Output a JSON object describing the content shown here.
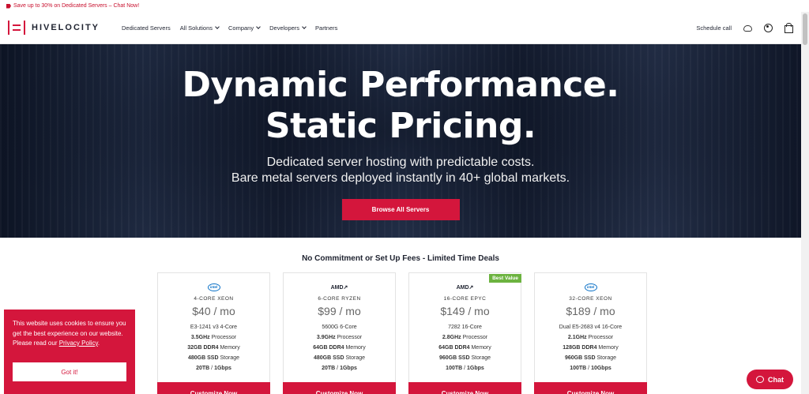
{
  "promo": {
    "text": "Save up to 30% on Dedicated Servers – Chat Now!"
  },
  "nav": {
    "logo": "HIVELOCITY",
    "links": [
      "Dedicated Servers",
      "All Solutions",
      "Company",
      "Developers",
      "Partners"
    ],
    "schedule": "Schedule call"
  },
  "hero": {
    "title_line1": "Dynamic Performance.",
    "title_line2": "Static Pricing.",
    "sub_line1": "Dedicated server hosting with predictable costs.",
    "sub_line2": "Bare metal servers deployed instantly in 40+ global markets.",
    "cta": "Browse All Servers"
  },
  "deals_title": "No Commitment or Set Up Fees - Limited Time Deals",
  "cards": [
    {
      "brand": "intel",
      "cpu": "4-CORE XEON",
      "price": "$40 / mo",
      "s1a": "E3-1241 v3 4-Core",
      "s1b": "",
      "s2a": "3.5GHz",
      "s2b": " Processor",
      "s3a": "32GB DDR4",
      "s3b": " Memory",
      "s4a": "480GB SSD",
      "s4b": " Storage",
      "s5a": "20TB",
      "s5b": " / ",
      "s5c": "1Gbps",
      "button": "Customize Now"
    },
    {
      "brand": "AMD",
      "cpu": "6-CORE RYZEN",
      "price": "$99 / mo",
      "s1a": "5600G 6-Core",
      "s1b": "",
      "s2a": "3.9GHz",
      "s2b": " Processor",
      "s3a": "64GB DDR4",
      "s3b": " Memory",
      "s4a": "480GB SSD",
      "s4b": " Storage",
      "s5a": "20TB",
      "s5b": " / ",
      "s5c": "1Gbps",
      "button": "Customize Now"
    },
    {
      "brand": "AMD",
      "cpu": "16-CORE EPYC",
      "price": "$149 / mo",
      "s1a": "7282 16-Core",
      "s1b": "",
      "s2a": "2.8GHz",
      "s2b": " Processor",
      "s3a": "64GB DDR4",
      "s3b": " Memory",
      "s4a": "960GB SSD",
      "s4b": " Storage",
      "s5a": "100TB",
      "s5b": " / ",
      "s5c": "1Gbps",
      "button": "Customize Now",
      "badge": "Best Value"
    },
    {
      "brand": "intel",
      "cpu": "32-CORE XEON",
      "price": "$189 / mo",
      "s1a": "Dual E5-2683 v4 16-Core",
      "s1b": "",
      "s2a": "2.1GHz",
      "s2b": " Processor",
      "s3a": "128GB DDR4",
      "s3b": " Memory",
      "s4a": "960GB SSD",
      "s4b": " Storage",
      "s5a": "100TB",
      "s5b": " / ",
      "s5c": "10Gbps",
      "button": "Customize Now"
    }
  ],
  "cookie": {
    "text": "This website uses cookies to ensure you get the best experience on our website. Please read our ",
    "link": "Privacy Policy",
    "end": ".",
    "button": "Got it!"
  },
  "chat": {
    "label": "Chat"
  },
  "colors": {
    "brand_red": "#d4163c",
    "best_value_green": "#6cb33f"
  }
}
